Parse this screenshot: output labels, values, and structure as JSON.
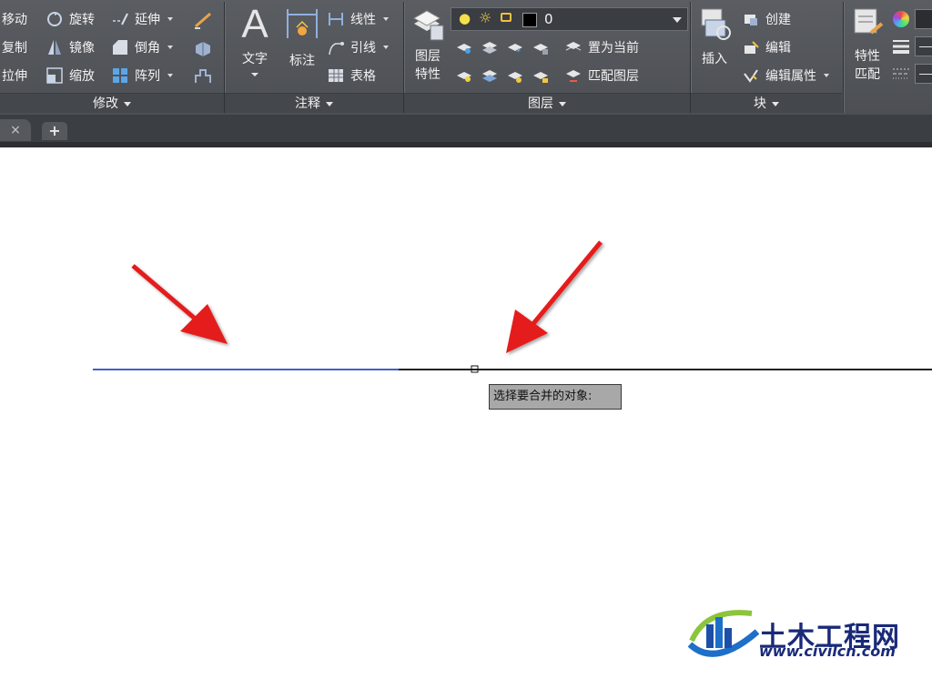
{
  "ribbon": {
    "modify": {
      "title": "修改",
      "items": [
        "移动",
        "旋转",
        "延伸",
        "复制",
        "镜像",
        "倒角",
        "拉伸",
        "缩放",
        "阵列"
      ]
    },
    "annotate": {
      "title": "注释",
      "big_text": "文字",
      "big_dim": "标注",
      "items": [
        "线性",
        "引线",
        "表格"
      ]
    },
    "layers": {
      "title": "图层",
      "big_props": "图层\n特性",
      "current_layer": "0",
      "items": [
        "置为当前",
        "匹配图层"
      ]
    },
    "block": {
      "title": "块",
      "big_insert": "插入",
      "items": [
        "创建",
        "编辑",
        "编辑属性"
      ]
    },
    "properties": {
      "big_match": "特性\n匹配"
    }
  },
  "tabs": {
    "close_glyph": "×",
    "add_glyph": "+"
  },
  "canvas": {
    "tooltip": "选择要合并的对象:",
    "colors": {
      "selected_line": "#3f5fc8",
      "line": "#222222",
      "arrow": "#e51a1a"
    }
  },
  "watermark": {
    "name": "土木工程网",
    "url": "www.civilcn.com"
  }
}
